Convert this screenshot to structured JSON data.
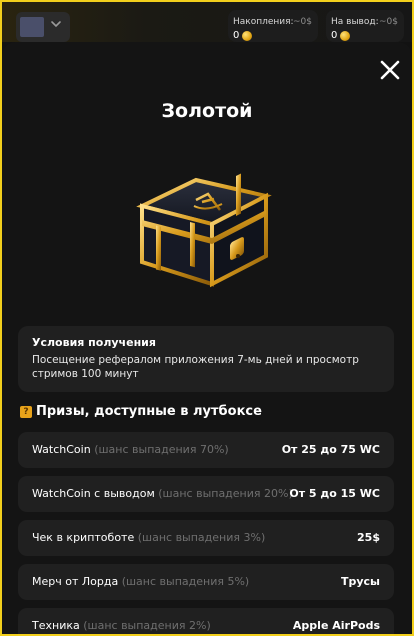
{
  "header": {
    "accumulations": {
      "label": "Накопления:",
      "approx": "~0$",
      "value": "0"
    },
    "withdraw": {
      "label": "На вывод:",
      "approx": "~0$",
      "value": "0"
    }
  },
  "modal": {
    "title": "Золотой",
    "conditions": {
      "title": "Условия получения",
      "text": "Посещение рефералом приложения 7-мь дней и просмотр стримов 100 минут"
    },
    "prizes_heading": "Призы, доступные в лутбоксе",
    "prizes": [
      {
        "name": "WatchCoin",
        "chance": "(шанс выпадения 70%)",
        "value": "От 25 до 75 WC"
      },
      {
        "name": "WatchCoin с выводом",
        "chance": "(шанс выпадения 20%)",
        "value": "От 5 до 15 WC"
      },
      {
        "name": "Чек в криптоботе",
        "chance": "(шанс выпадения 3%)",
        "value": "25$"
      },
      {
        "name": "Мерч от Лорда",
        "chance": "(шанс выпадения 5%)",
        "value": "Трусы"
      },
      {
        "name": "Техника",
        "chance": "(шанс выпадения 2%)",
        "value": "Apple AirPods"
      }
    ]
  },
  "colors": {
    "accent_border": "#f2cf1c",
    "gold": "#e2a614",
    "card_bg": "#202020",
    "muted_text": "#6f6f6f"
  },
  "icons": {
    "close": "close-icon",
    "chevron": "chevron-down-icon",
    "coin": "coin-icon",
    "question": "question-box-icon",
    "chest": "golden-chest-icon"
  }
}
